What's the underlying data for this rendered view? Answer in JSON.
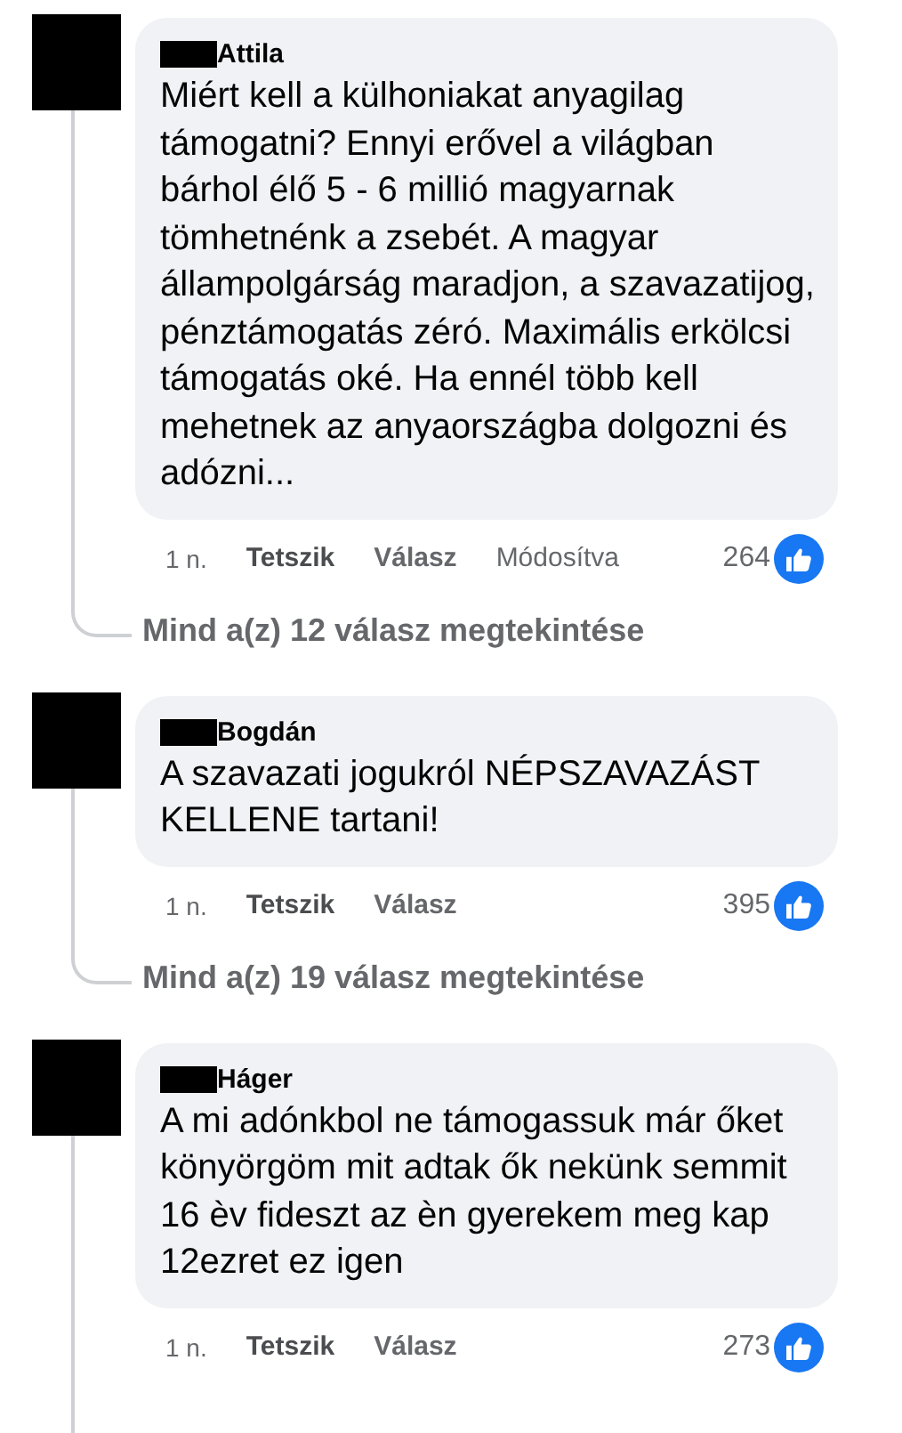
{
  "comments": [
    {
      "name": "Attila",
      "text": "Miért kell a külhoniakat anyagilag támogatni? Ennyi erővel a világban bárhol élő 5 - 6 millió magyarnak tömhetnénk a zsebét. A magyar állampolgárság maradjon, a szavazatijog, pénztámogatás zéró. Maximális erkölcsi támogatás oké. Ha ennél több kell mehetnek az anyaországba dolgozni és adózni...",
      "time": "1 n.",
      "like": "Tetszik",
      "reply": "Válasz",
      "edited": "Módosítva",
      "reactions": "264",
      "replies_link": "Mind a(z) 12 válasz megtekintése"
    },
    {
      "name": "Bogdán",
      "text": "A szavazati jogukról NÉPSZAVAZÁST KELLENE tartani!",
      "time": "1 n.",
      "like": "Tetszik",
      "reply": "Válasz",
      "reactions": "395",
      "replies_link": "Mind a(z) 19 válasz megtekintése"
    },
    {
      "name": "Háger",
      "text": "A mi adónkbol ne támogassuk már őket könyörgöm mit adtak ők nekünk semmit 16 èv fideszt az èn gyerekem meg kap 12ezret ez igen",
      "time": "1 n.",
      "like": "Tetszik",
      "reply": "Válasz",
      "reactions": "273"
    }
  ]
}
